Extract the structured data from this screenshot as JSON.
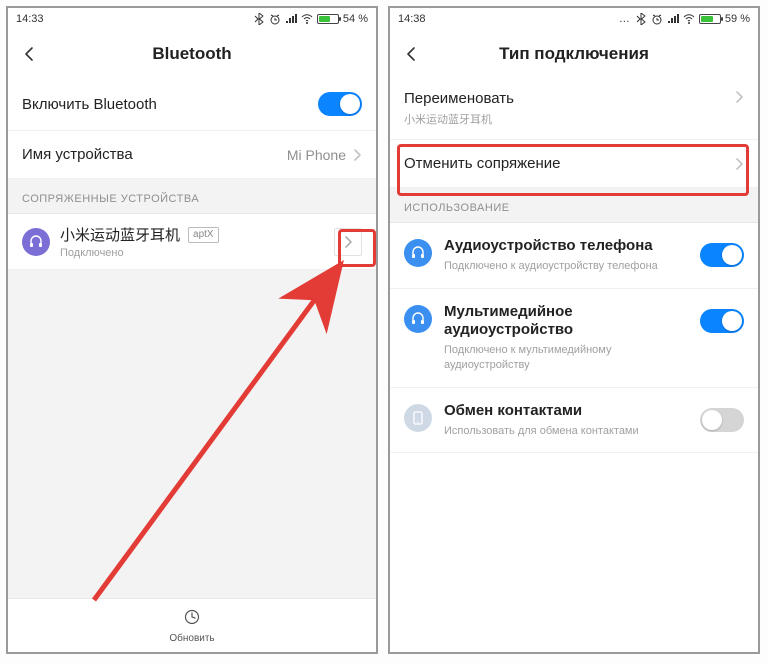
{
  "left": {
    "statusbar": {
      "time": "14:33",
      "battery": "54 %"
    },
    "title": "Bluetooth",
    "rows": {
      "bt_toggle_label": "Включить Bluetooth",
      "name_label": "Имя устройства",
      "name_value": "Mi Phone"
    },
    "section_paired": "СОПРЯЖЕННЫЕ УСТРОЙСТВА",
    "device": {
      "name": "小米运动蓝牙耳机",
      "codec": "aptX",
      "status": "Подключено"
    },
    "refresh": "Обновить"
  },
  "right": {
    "statusbar": {
      "time": "14:38",
      "battery": "59 %"
    },
    "title": "Тип подключения",
    "rename_label": "Переименовать",
    "rename_sub": "小米运动蓝牙耳机",
    "unpair_label": "Отменить сопряжение",
    "section_usage": "ИСПОЛЬЗОВАНИЕ",
    "usage": {
      "phone_audio_title": "Аудиоустройство телефона",
      "phone_audio_sub": "Подключено к аудиоустройству телефона",
      "media_audio_title": "Мультимедийное аудиоустройство",
      "media_audio_sub": "Подключено к мультимедийному аудиоустройству",
      "contacts_title": "Обмен контактами",
      "contacts_sub": "Использовать для обмена контактами"
    }
  }
}
